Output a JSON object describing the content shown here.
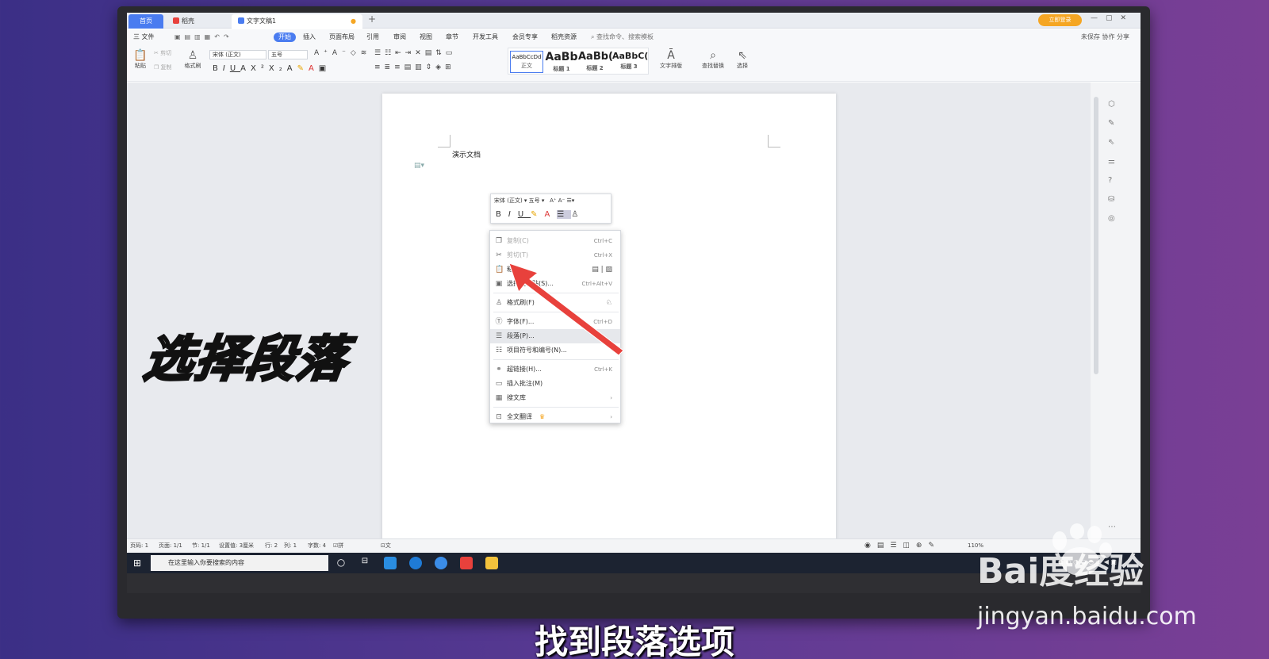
{
  "tabs": {
    "home": "首页",
    "t2": "稻壳",
    "t3": "文字文稿1"
  },
  "tabbar": {
    "login": "立即登录"
  },
  "menubar": {
    "file": "三 文件",
    "items": [
      "开始",
      "插入",
      "页面布局",
      "引用",
      "审阅",
      "视图",
      "章节",
      "开发工具",
      "会员专享",
      "稻壳资源"
    ],
    "search": "查找命令、搜索模板",
    "right": "未保存  协作  分享"
  },
  "ribbon": {
    "paste": "粘贴",
    "cut": "剪切",
    "copy": "复制",
    "formatbrush": "格式刷",
    "font": "宋体 (正文)",
    "size": "五号",
    "styles": [
      {
        "sample": "AaBbCcDd",
        "name": "正文"
      },
      {
        "sample": "AaBb",
        "name": "标题 1"
      },
      {
        "sample": "AaBb(",
        "name": "标题 2"
      },
      {
        "sample": "AaBbC(",
        "name": "标题 3"
      }
    ],
    "layout": "文字排版",
    "findreplace": "查找替换",
    "select": "选择"
  },
  "document": {
    "text": "演示文档"
  },
  "minitb": {
    "font": "宋体 (正文)",
    "size": "五号"
  },
  "context_menu": [
    {
      "label": "复制(C)",
      "shortcut": "Ctrl+C",
      "icon": "copy-icon",
      "disabled": true
    },
    {
      "label": "剪切(T)",
      "shortcut": "Ctrl+X",
      "icon": "scissors-icon",
      "disabled": true
    },
    {
      "label": "粘贴",
      "shortcut": "",
      "icon": "paste-icon",
      "disabled": false
    },
    {
      "label": "选择性粘贴(S)...",
      "shortcut": "Ctrl+Alt+V",
      "icon": "paste-special-icon",
      "disabled": false
    },
    {
      "label": "格式刷(F)",
      "shortcut": "",
      "icon": "format-brush-icon",
      "disabled": false
    },
    {
      "label": "字体(F)...",
      "shortcut": "Ctrl+D",
      "icon": "font-icon",
      "disabled": false
    },
    {
      "label": "段落(P)...",
      "shortcut": "",
      "icon": "paragraph-icon",
      "disabled": false,
      "highlighted": true
    },
    {
      "label": "项目符号和编号(N)...",
      "shortcut": "",
      "icon": "bullet-list-icon",
      "disabled": false
    },
    {
      "label": "超链接(H)...",
      "shortcut": "Ctrl+K",
      "icon": "link-icon",
      "disabled": false
    },
    {
      "label": "插入批注(M)",
      "shortcut": "",
      "icon": "comment-icon",
      "disabled": false
    },
    {
      "label": "搜文库",
      "shortcut": "›",
      "icon": "library-icon",
      "disabled": false
    },
    {
      "label": "全文翻译",
      "shortcut": "›",
      "icon": "translate-icon",
      "disabled": false
    }
  ],
  "statusbar": {
    "page": "页码: 1",
    "pages": "页面: 1/1",
    "section": "节: 1/1",
    "setting": "设置值: 3厘米",
    "row": "行: 2",
    "col": "列: 1",
    "words": "字数: 4",
    "spell": "拼写检查",
    "proof": "文档校对",
    "zoom": "110%"
  },
  "taskbar": {
    "search": "在这里输入你要搜索的内容"
  },
  "overlay": {
    "title": "选择段落",
    "subtitle": "找到段落选项"
  },
  "watermark": {
    "logo": "Bai度经验",
    "url": "jingyan.baidu.com"
  },
  "colors": {
    "accent": "#4a7cf0",
    "arrow": "#e8413c",
    "login": "#f5a623"
  }
}
